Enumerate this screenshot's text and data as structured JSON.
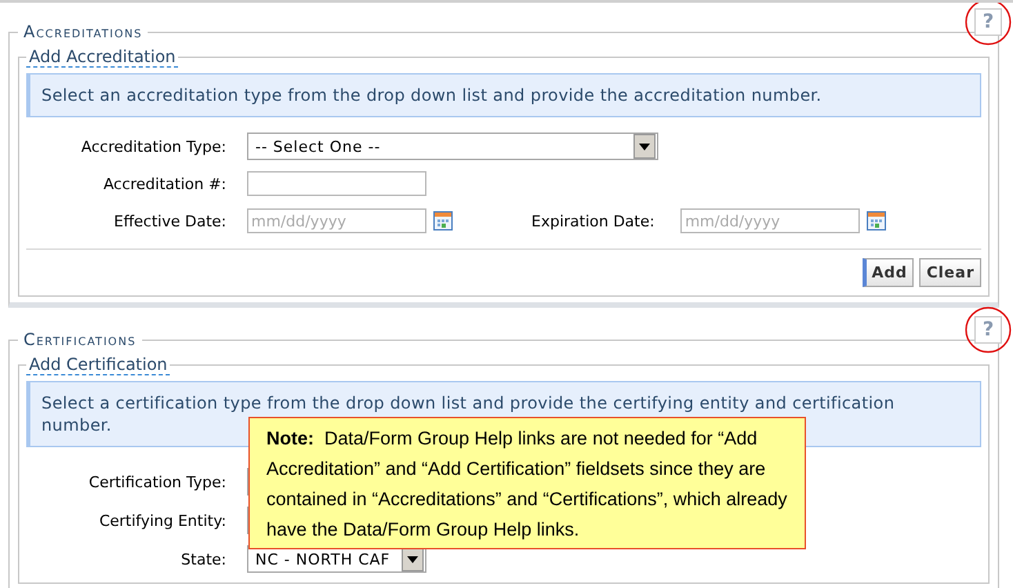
{
  "sections": [
    {
      "title": "Accreditations",
      "help": "?",
      "fieldset": {
        "legend": "Add Accreditation",
        "info": "Select an accreditation type from the drop down list and provide the accreditation number.",
        "rows": [
          [
            {
              "kind": "select",
              "label": "Accreditation Type:",
              "value": "-- Select One --"
            }
          ],
          [
            {
              "kind": "text",
              "label": "Accreditation #:"
            }
          ],
          [
            {
              "kind": "date",
              "label": "Effective Date:",
              "placeholder": "mm/dd/yyyy"
            },
            {
              "kind": "date",
              "label": "Expiration Date:",
              "placeholder": "mm/dd/yyyy"
            }
          ]
        ],
        "buttons": [
          {
            "label": "Add",
            "primary": true
          },
          {
            "label": "Clear",
            "primary": false
          }
        ]
      }
    },
    {
      "title": "Certifications",
      "help": "?",
      "fieldset": {
        "legend": "Add Certification",
        "info": "Select a certification type from the drop down list and provide the certifying entity and certification number.",
        "rows": [
          [
            {
              "kind": "covered",
              "label": "Certification Type:"
            }
          ],
          [
            {
              "kind": "covered",
              "label": "Certifying Entity:"
            }
          ],
          [
            {
              "kind": "short-select",
              "label": "State:",
              "value": "NC - NORTH CAF"
            }
          ]
        ]
      }
    }
  ],
  "note": {
    "label": "Note:",
    "text": "Data/Form Group Help links are not needed for “Add Accreditation” and “Add Certification” fieldsets since they are contained in “Accreditations” and “Certifications”, which already have the Data/Form Group Help links."
  }
}
